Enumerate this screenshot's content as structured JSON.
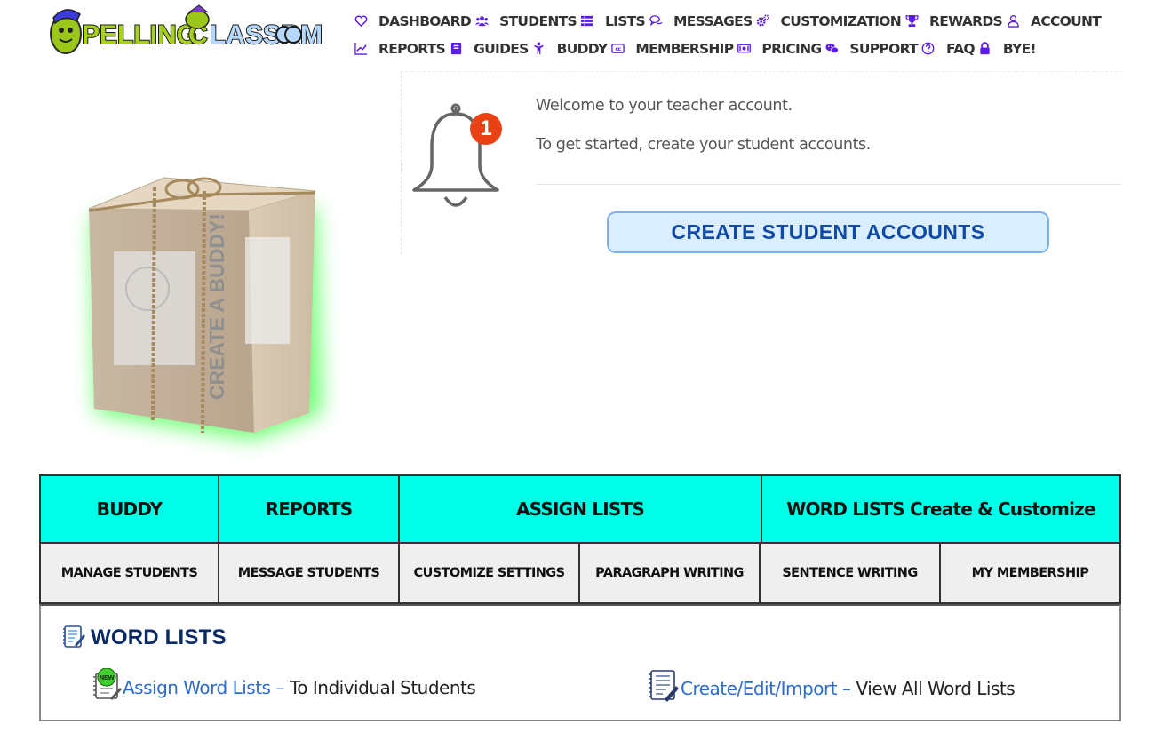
{
  "app": {
    "logo_text": "SpellingClassroom"
  },
  "nav": {
    "row1": [
      {
        "label": "DASHBOARD",
        "icon": "heart-icon"
      },
      {
        "label": "STUDENTS",
        "icon": "users-icon"
      },
      {
        "label": "LISTS",
        "icon": "list-icon"
      },
      {
        "label": "MESSAGES",
        "icon": "comments-icon"
      },
      {
        "label": "CUSTOMIZATION",
        "icon": "cogs-icon"
      },
      {
        "label": "REWARDS",
        "icon": "trophy-icon"
      },
      {
        "label": "ACCOUNT",
        "icon": "user-icon"
      }
    ],
    "row2": [
      {
        "label": "REPORTS",
        "icon": "chart-line-icon"
      },
      {
        "label": "GUIDES",
        "icon": "book-icon"
      },
      {
        "label": "BUDDY",
        "icon": "child-icon"
      },
      {
        "label": "MEMBERSHIP",
        "icon": "cc-icon"
      },
      {
        "label": "PRICING",
        "icon": "money-bill-icon"
      },
      {
        "label": "SUPPORT",
        "icon": "wechat-icon"
      },
      {
        "label": "FAQ",
        "icon": "question-circle-icon"
      },
      {
        "label": "BYE!",
        "icon": "lock-icon"
      }
    ]
  },
  "notification": {
    "badge_count": "1",
    "welcome": "Welcome to your teacher account.",
    "get_started": "To get started, create your student accounts.",
    "create_button": "CREATE STUDENT ACCOUNTS"
  },
  "buddy_box": {
    "label": "CREATE A BUDDY!"
  },
  "grid": {
    "row1": [
      "BUDDY",
      "REPORTS",
      "ASSIGN LISTS",
      "WORD LISTS Create & Customize"
    ],
    "row2": [
      "MANAGE STUDENTS",
      "MESSAGE STUDENTS",
      "CUSTOMIZE SETTINGS",
      "PARAGRAPH WRITING",
      "SENTENCE WRITING",
      "MY MEMBERSHIP"
    ]
  },
  "word_lists": {
    "title": "WORD LISTS",
    "assign": {
      "link": "Assign Word Lists",
      "dash": "–",
      "rest": "To Individual Students",
      "icon_badge": "NEW"
    },
    "create": {
      "link": "Create/Edit/Import",
      "dash": "–",
      "rest": "View All Word Lists"
    }
  },
  "colors": {
    "accent_purple": "#5a1ce6",
    "cyan_cell": "#00ffe6",
    "badge_red": "#ea4114",
    "button_text": "#0f4aa6",
    "link_blue": "#2e6bd0",
    "heading_navy": "#0a2a66"
  }
}
